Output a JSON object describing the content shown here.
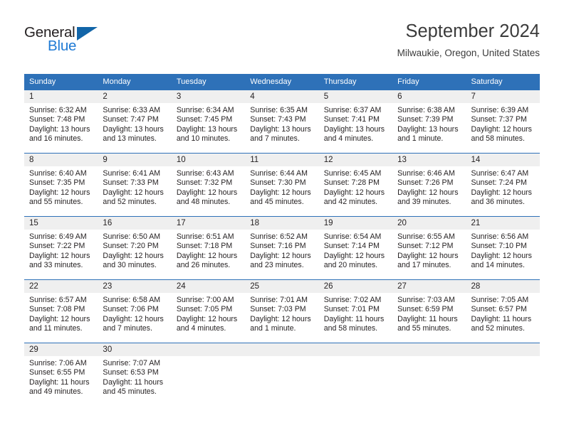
{
  "brand": {
    "name_part1": "General",
    "name_part2": "Blue",
    "logo_icon": "triangle-icon",
    "color_dark": "#231f20",
    "color_blue": "#1f7ad4",
    "triangle_color": "#1265a8"
  },
  "header": {
    "title": "September 2024",
    "subtitle": "Milwaukie, Oregon, United States"
  },
  "theme": {
    "header_blue": "#2e71b8",
    "daynum_band": "#efefef",
    "text": "#231f20"
  },
  "weekday_headers": [
    "Sunday",
    "Monday",
    "Tuesday",
    "Wednesday",
    "Thursday",
    "Friday",
    "Saturday"
  ],
  "weeks": [
    [
      {
        "day": "1",
        "sunrise": "Sunrise: 6:32 AM",
        "sunset": "Sunset: 7:48 PM",
        "daylight": "Daylight: 13 hours and 16 minutes."
      },
      {
        "day": "2",
        "sunrise": "Sunrise: 6:33 AM",
        "sunset": "Sunset: 7:47 PM",
        "daylight": "Daylight: 13 hours and 13 minutes."
      },
      {
        "day": "3",
        "sunrise": "Sunrise: 6:34 AM",
        "sunset": "Sunset: 7:45 PM",
        "daylight": "Daylight: 13 hours and 10 minutes."
      },
      {
        "day": "4",
        "sunrise": "Sunrise: 6:35 AM",
        "sunset": "Sunset: 7:43 PM",
        "daylight": "Daylight: 13 hours and 7 minutes."
      },
      {
        "day": "5",
        "sunrise": "Sunrise: 6:37 AM",
        "sunset": "Sunset: 7:41 PM",
        "daylight": "Daylight: 13 hours and 4 minutes."
      },
      {
        "day": "6",
        "sunrise": "Sunrise: 6:38 AM",
        "sunset": "Sunset: 7:39 PM",
        "daylight": "Daylight: 13 hours and 1 minute."
      },
      {
        "day": "7",
        "sunrise": "Sunrise: 6:39 AM",
        "sunset": "Sunset: 7:37 PM",
        "daylight": "Daylight: 12 hours and 58 minutes."
      }
    ],
    [
      {
        "day": "8",
        "sunrise": "Sunrise: 6:40 AM",
        "sunset": "Sunset: 7:35 PM",
        "daylight": "Daylight: 12 hours and 55 minutes."
      },
      {
        "day": "9",
        "sunrise": "Sunrise: 6:41 AM",
        "sunset": "Sunset: 7:33 PM",
        "daylight": "Daylight: 12 hours and 52 minutes."
      },
      {
        "day": "10",
        "sunrise": "Sunrise: 6:43 AM",
        "sunset": "Sunset: 7:32 PM",
        "daylight": "Daylight: 12 hours and 48 minutes."
      },
      {
        "day": "11",
        "sunrise": "Sunrise: 6:44 AM",
        "sunset": "Sunset: 7:30 PM",
        "daylight": "Daylight: 12 hours and 45 minutes."
      },
      {
        "day": "12",
        "sunrise": "Sunrise: 6:45 AM",
        "sunset": "Sunset: 7:28 PM",
        "daylight": "Daylight: 12 hours and 42 minutes."
      },
      {
        "day": "13",
        "sunrise": "Sunrise: 6:46 AM",
        "sunset": "Sunset: 7:26 PM",
        "daylight": "Daylight: 12 hours and 39 minutes."
      },
      {
        "day": "14",
        "sunrise": "Sunrise: 6:47 AM",
        "sunset": "Sunset: 7:24 PM",
        "daylight": "Daylight: 12 hours and 36 minutes."
      }
    ],
    [
      {
        "day": "15",
        "sunrise": "Sunrise: 6:49 AM",
        "sunset": "Sunset: 7:22 PM",
        "daylight": "Daylight: 12 hours and 33 minutes."
      },
      {
        "day": "16",
        "sunrise": "Sunrise: 6:50 AM",
        "sunset": "Sunset: 7:20 PM",
        "daylight": "Daylight: 12 hours and 30 minutes."
      },
      {
        "day": "17",
        "sunrise": "Sunrise: 6:51 AM",
        "sunset": "Sunset: 7:18 PM",
        "daylight": "Daylight: 12 hours and 26 minutes."
      },
      {
        "day": "18",
        "sunrise": "Sunrise: 6:52 AM",
        "sunset": "Sunset: 7:16 PM",
        "daylight": "Daylight: 12 hours and 23 minutes."
      },
      {
        "day": "19",
        "sunrise": "Sunrise: 6:54 AM",
        "sunset": "Sunset: 7:14 PM",
        "daylight": "Daylight: 12 hours and 20 minutes."
      },
      {
        "day": "20",
        "sunrise": "Sunrise: 6:55 AM",
        "sunset": "Sunset: 7:12 PM",
        "daylight": "Daylight: 12 hours and 17 minutes."
      },
      {
        "day": "21",
        "sunrise": "Sunrise: 6:56 AM",
        "sunset": "Sunset: 7:10 PM",
        "daylight": "Daylight: 12 hours and 14 minutes."
      }
    ],
    [
      {
        "day": "22",
        "sunrise": "Sunrise: 6:57 AM",
        "sunset": "Sunset: 7:08 PM",
        "daylight": "Daylight: 12 hours and 11 minutes."
      },
      {
        "day": "23",
        "sunrise": "Sunrise: 6:58 AM",
        "sunset": "Sunset: 7:06 PM",
        "daylight": "Daylight: 12 hours and 7 minutes."
      },
      {
        "day": "24",
        "sunrise": "Sunrise: 7:00 AM",
        "sunset": "Sunset: 7:05 PM",
        "daylight": "Daylight: 12 hours and 4 minutes."
      },
      {
        "day": "25",
        "sunrise": "Sunrise: 7:01 AM",
        "sunset": "Sunset: 7:03 PM",
        "daylight": "Daylight: 12 hours and 1 minute."
      },
      {
        "day": "26",
        "sunrise": "Sunrise: 7:02 AM",
        "sunset": "Sunset: 7:01 PM",
        "daylight": "Daylight: 11 hours and 58 minutes."
      },
      {
        "day": "27",
        "sunrise": "Sunrise: 7:03 AM",
        "sunset": "Sunset: 6:59 PM",
        "daylight": "Daylight: 11 hours and 55 minutes."
      },
      {
        "day": "28",
        "sunrise": "Sunrise: 7:05 AM",
        "sunset": "Sunset: 6:57 PM",
        "daylight": "Daylight: 11 hours and 52 minutes."
      }
    ],
    [
      {
        "day": "29",
        "sunrise": "Sunrise: 7:06 AM",
        "sunset": "Sunset: 6:55 PM",
        "daylight": "Daylight: 11 hours and 49 minutes."
      },
      {
        "day": "30",
        "sunrise": "Sunrise: 7:07 AM",
        "sunset": "Sunset: 6:53 PM",
        "daylight": "Daylight: 11 hours and 45 minutes."
      },
      {
        "day": "",
        "sunrise": "",
        "sunset": "",
        "daylight": ""
      },
      {
        "day": "",
        "sunrise": "",
        "sunset": "",
        "daylight": ""
      },
      {
        "day": "",
        "sunrise": "",
        "sunset": "",
        "daylight": ""
      },
      {
        "day": "",
        "sunrise": "",
        "sunset": "",
        "daylight": ""
      },
      {
        "day": "",
        "sunrise": "",
        "sunset": "",
        "daylight": ""
      }
    ]
  ]
}
